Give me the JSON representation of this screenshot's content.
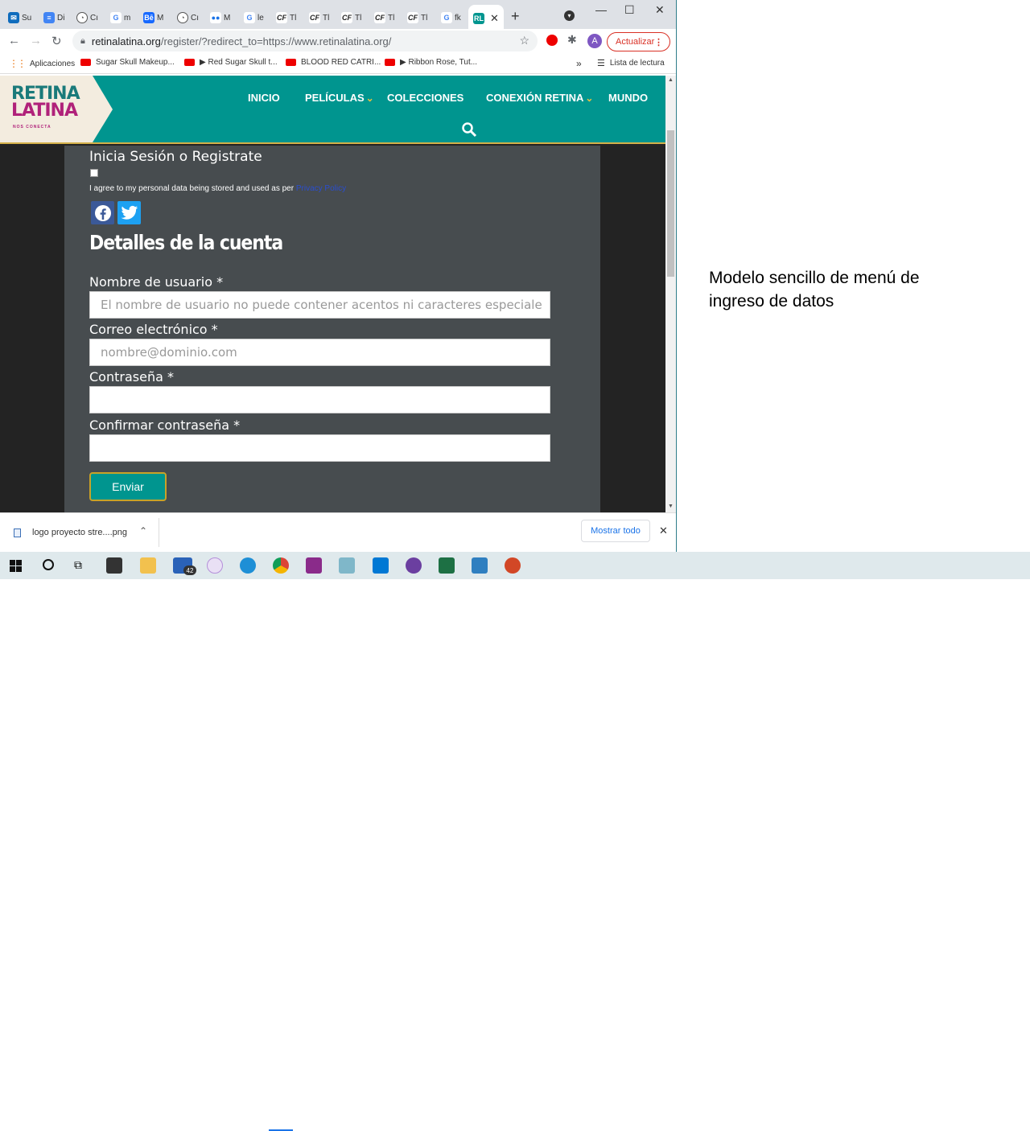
{
  "browser": {
    "tabs": [
      {
        "label": "Su",
        "icon": "outlook-icon",
        "color": "#0f6cbd"
      },
      {
        "label": "Di",
        "icon": "docs-icon",
        "color": "#4285f4"
      },
      {
        "label": "Cı",
        "icon": "speedometer-icon",
        "color": "#555555"
      },
      {
        "label": "m",
        "icon": "google-icon",
        "color": "#4285f4"
      },
      {
        "label": "M",
        "icon": "behance-icon",
        "color": "#1769ff"
      },
      {
        "label": "Cı",
        "icon": "speedometer-icon",
        "color": "#555555"
      },
      {
        "label": "M",
        "icon": "meet-icon",
        "color": "#1a73e8"
      },
      {
        "label": "le",
        "icon": "google-icon",
        "color": "#4285f4"
      },
      {
        "label": "Tl",
        "icon": "cf-icon",
        "color": "#222222"
      },
      {
        "label": "Tl",
        "icon": "cf-icon",
        "color": "#222222"
      },
      {
        "label": "Tl",
        "icon": "cf-icon",
        "color": "#222222"
      },
      {
        "label": "Tl",
        "icon": "cf-icon",
        "color": "#222222"
      },
      {
        "label": "Tl",
        "icon": "cf-icon",
        "color": "#222222"
      },
      {
        "label": "fk",
        "icon": "google-icon",
        "color": "#4285f4"
      },
      {
        "label": "RL",
        "icon": "retina-latina-icon",
        "color": "#00958f",
        "active": true
      }
    ],
    "address": {
      "host": "retinalatina.org",
      "path": "/register/?redirect_to=https://www.retinalatina.org/"
    },
    "profile_initial": "A",
    "update_label": "Actualizar",
    "bookmarks": [
      "Aplicaciones",
      "Sugar Skull Makeup...",
      "▶ Red Sugar Skull t...",
      "BLOOD RED CATRI...",
      "▶ Ribbon Rose, Tut..."
    ],
    "bookmarks_overflow": "»",
    "reading_list": "Lista de lectura"
  },
  "site": {
    "logo_line1": "RETINA",
    "logo_line2": "LATINA",
    "logo_tagline": "NOS CONECTA",
    "nav": [
      "INICIO",
      "PELÍCULAS",
      "COLECCIONES",
      "CONEXIÓN RETINA",
      "MUNDO"
    ],
    "colors": {
      "header": "#00958f",
      "accent": "#d4b04a",
      "panel": "#474c4f"
    }
  },
  "form": {
    "login_heading": "Inicia Sesión o Registrate",
    "consent_text": "I agree to my personal data being stored and used as per",
    "consent_link": "Privacy Policy",
    "section_title": "Detalles de la cuenta",
    "fields": [
      {
        "label": "Nombre de usuario *",
        "placeholder": "El nombre de usuario no puede contener acentos ni caracteres especiale"
      },
      {
        "label": "Correo electrónico *",
        "placeholder": "nombre@dominio.com"
      },
      {
        "label": "Contraseña *",
        "placeholder": ""
      },
      {
        "label": "Confirmar contraseña *",
        "placeholder": ""
      }
    ],
    "submit_label": "Enviar"
  },
  "downloads": {
    "file": "logo proyecto stre....png",
    "show_all": "Mostrar todo"
  },
  "taskbar": {
    "mail_badge": "42"
  },
  "caption": "Modelo sencillo de menú de ingreso de datos"
}
